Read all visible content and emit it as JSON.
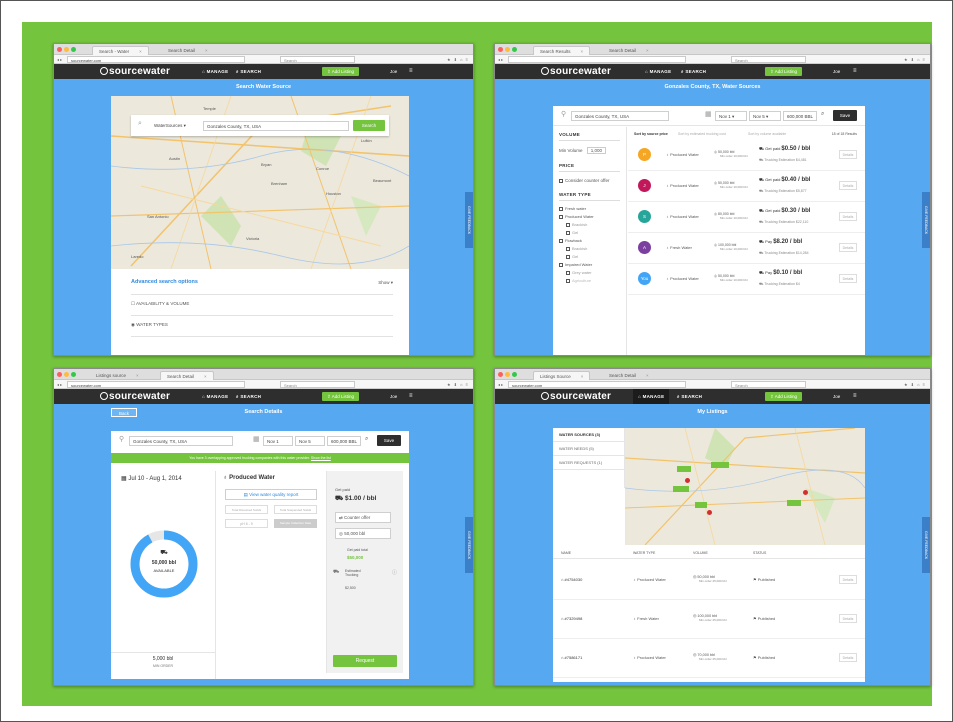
{
  "colors": {
    "green": "#74c43e",
    "blue": "#56a8f0",
    "dark": "#2e2e2e",
    "purple": "#9c3d9a",
    "magenta": "#c2185b"
  },
  "nav": {
    "logo": "sourcewater",
    "manage": "MANAGE",
    "search": "SEARCH",
    "add_listing": "Add Listing",
    "user": "Joe",
    "feedback": "GIVE FEEDBACK"
  },
  "browser": {
    "url": "sourcewater.com",
    "search_placeholder": "Search"
  },
  "panel1": {
    "tabs": [
      "Search - Water",
      "Search Detail"
    ],
    "title": "Search Water Source",
    "type_select": "WaterSources",
    "location": "Gonzales County, TX, USA",
    "search_btn": "Search",
    "advanced": "Advanced search options",
    "show": "Show",
    "opt1": "AVAILABILITY & VOLUME",
    "opt2": "WATER TYPES",
    "cities": [
      "Temple",
      "Austin",
      "San Antonio",
      "Victoria",
      "Houston",
      "Brenham",
      "Conroe",
      "Beaumont",
      "Bryan",
      "Lufkin",
      "Laredo"
    ]
  },
  "panel2": {
    "tabs": [
      "Search Results",
      "Search Detail"
    ],
    "title": "Gonzales County, TX, Water Sources",
    "location": "Gonzales County, TX, USA",
    "date_from": "Nov 1",
    "date_to": "Nov 5",
    "volume": "600,000 BBL",
    "save": "Save",
    "volume_head": "VOLUME",
    "min_volume_label": "Min Volume",
    "min_volume": "1,000",
    "price_head": "PRICE",
    "counter": "Consider counter offer",
    "water_type_head": "WATER TYPE",
    "types": [
      "Fresh water",
      "Produced Water",
      "Brackish",
      "Gel",
      "Flowback",
      "Brackish",
      "Gel",
      "Impaired Water",
      "Grey water",
      "Agriculture"
    ],
    "sort": [
      "Sort by source price",
      "Sort by estimated trucking cost",
      "Sort by volume available"
    ],
    "result_count": "18 of 18 Results",
    "results": [
      {
        "initial": "P",
        "color": "#f5a623",
        "type": "Produced Water",
        "vol": "50,000 bbl",
        "min": "Min order 10,000 bbl",
        "price_label": "Get paid",
        "price": "$0.50 / bbl",
        "truck": "Trucking Estimation $4,481",
        "details": "Details"
      },
      {
        "initial": "J",
        "color": "#c2185b",
        "type": "Produced Water",
        "vol": "50,000 bbl",
        "min": "Min order 10,000 bbl",
        "price_label": "Get paid",
        "price": "$0.40 / bbl",
        "truck": "Trucking Estimation $5,877",
        "details": "Details"
      },
      {
        "initial": "S",
        "color": "#26a69a",
        "type": "Produced Water",
        "vol": "80,000 bbl",
        "min": "Min order 10,000 bbl",
        "price_label": "Get paid",
        "price": "$0.30 / bbl",
        "truck": "Trucking Estimation $22,110",
        "details": "Details"
      },
      {
        "initial": "A",
        "color": "#7b3fa0",
        "type": "Fresh Water",
        "vol": "100,000 bbl",
        "min": "Min order 10,000 bbl",
        "price_label": "Pay",
        "price": "$8.20 / bbl",
        "truck": "Trucking Estimation $14,284",
        "details": "Details"
      },
      {
        "initial": "You",
        "color": "#42a5f5",
        "type": "Produced Water",
        "vol": "50,000 bbl",
        "min": "Min order 10,000 bbl",
        "price_label": "Pay",
        "price": "$0.10 / bbl",
        "truck": "Trucking Estimation $4",
        "details": "Details"
      }
    ]
  },
  "panel3": {
    "tabs": [
      "Listings source",
      "Search Detail"
    ],
    "title": "Search Details",
    "back": "Back",
    "location": "Gonzales County, TX, USA",
    "date_from": "Nov 1",
    "date_to": "Nov 5",
    "volume": "600,000 BBL",
    "save": "Save",
    "banner": "You have 3 overlapping approved trucking companies with this water provider.",
    "banner_link": "Show the list",
    "dates": "Jul 10 - Aug 1, 2014",
    "water_type": "Produced Water",
    "report": "View water quality report",
    "tags": [
      "Total Dissolved Solids",
      "Total Suspended Solids",
      "pH 6 - 9",
      "Sample Collection Date"
    ],
    "gauge_value": "50,000 bbl",
    "gauge_label": "AVAILABLE",
    "gauge_fraction": 0.92,
    "min_value": "5,000 bbl",
    "min_label": "MIN ORDER",
    "get_paid": "Get paid",
    "price": "$1.00 / bbl",
    "counter": "Counter offer",
    "counter_value": "50,000 bbl",
    "total_label": "Get paid total",
    "total": "$50,000",
    "est_label": "Estimated Trucking",
    "est": "$2,500",
    "request": "Request"
  },
  "panel4": {
    "tabs": [
      "Listings Source",
      "Search Detail"
    ],
    "title": "My Listings",
    "side": [
      "WATER SOURCES (3)",
      "WATER NEEDS (5)",
      "WATER REQUESTS (1)"
    ],
    "cols": [
      "NAME",
      "WATER TYPE",
      "VOLUME",
      "STATUS"
    ],
    "rows": [
      {
        "name": "#4754030",
        "type": "Produced Water",
        "vol": "50,000 bbl",
        "min": "Min order 25,000 bbl",
        "status": "Published",
        "details": "Details"
      },
      {
        "name": "#7329498",
        "type": "Fresh Water",
        "vol": "100,000 bbl",
        "min": "Min order 25,000 bbl",
        "status": "Published",
        "details": "Details"
      },
      {
        "name": "#7586171",
        "type": "Produced Water",
        "vol": "70,000 bbl",
        "min": "Min order 25,000 bbl",
        "status": "Published",
        "details": "Details"
      }
    ]
  }
}
